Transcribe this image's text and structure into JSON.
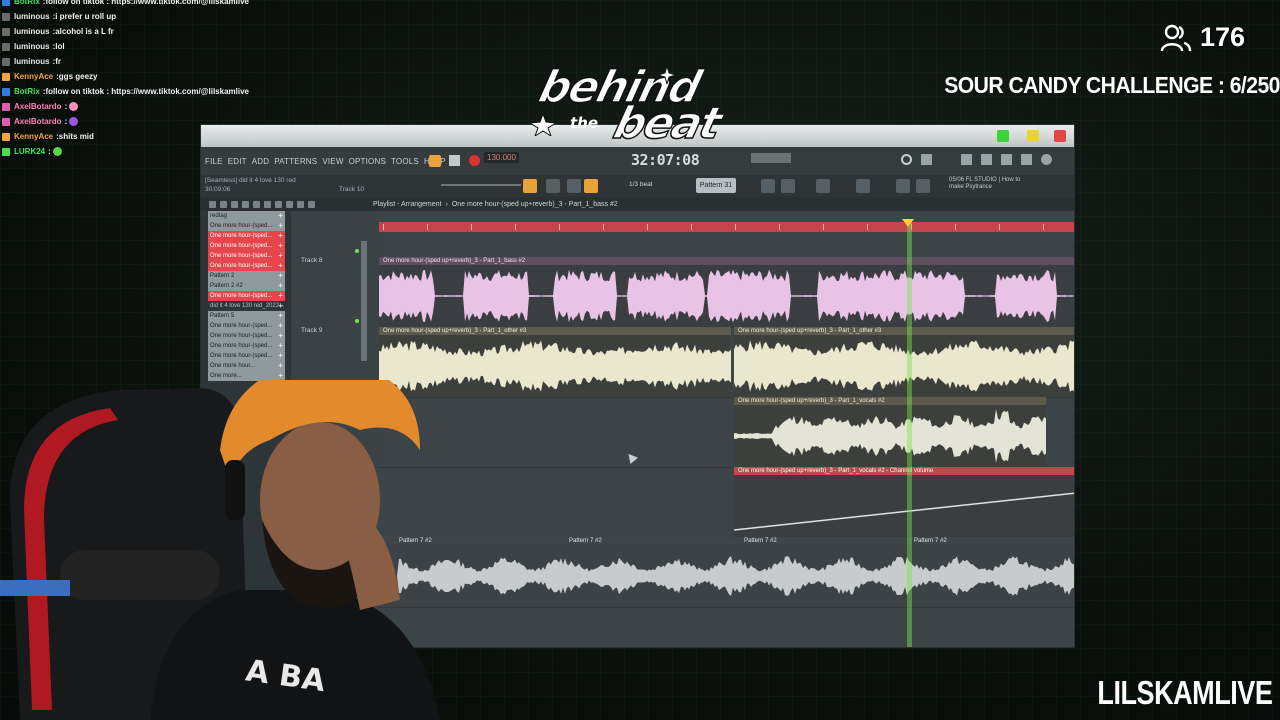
{
  "chat": [
    {
      "user": "BotRix",
      "message": "follow on tiktok : https://www.tiktok.com/@lilskamlive",
      "user_color": "#43e05a",
      "badge": "#2f7de0"
    },
    {
      "user": "luminous",
      "message": "i prefer u roll up",
      "user_color": "#e8e8e8",
      "badge": "#6a6a6a"
    },
    {
      "user": "luminous",
      "message": "alcohol is a L fr",
      "user_color": "#e8e8e8",
      "badge": "#6a6a6a"
    },
    {
      "user": "luminous",
      "message": "lol",
      "user_color": "#e8e8e8",
      "badge": "#6a6a6a"
    },
    {
      "user": "luminous",
      "message": "fr",
      "user_color": "#e8e8e8",
      "badge": "#6a6a6a"
    },
    {
      "user": "KennyAce",
      "message": "ggs geezy",
      "user_color": "#f3a43b",
      "badge": "#f3a43b"
    },
    {
      "user": "BotRix",
      "message": "follow on tiktok : https://www.tiktok.com/@lilskamlive",
      "user_color": "#43e05a",
      "badge": "#2f7de0"
    },
    {
      "user": "AxelBotardo",
      "message": "",
      "user_color": "#ff7eb3",
      "badge": "#e05cb0",
      "emote": "#ff8fbf"
    },
    {
      "user": "AxelBotardo",
      "message": "",
      "user_color": "#ff7eb3",
      "badge": "#e05cb0",
      "emote": "#9b59e8"
    },
    {
      "user": "KennyAce",
      "message": "shits mid",
      "user_color": "#f3a43b",
      "badge": "#f3a43b"
    },
    {
      "user": "LURK24",
      "message": "",
      "user_color": "#43e05a",
      "badge": "#43e05a",
      "emote": "#5ad44a"
    }
  ],
  "viewers": {
    "count": "176",
    "icon": "viewers-icon"
  },
  "challenge_text": "SOUR CANDY CHALLENGE : 6/250",
  "channel_handle": "LILSKAMLIVE",
  "logo": {
    "word1": "behind",
    "word2": "beat",
    "small": "the"
  },
  "fl": {
    "menu": [
      "FILE",
      "EDIT",
      "ADD",
      "PATTERNS",
      "VIEW",
      "OPTIONS",
      "TOOLS",
      "HELP"
    ],
    "time": "32:07:08",
    "tempo": "130.000",
    "pattern": "Pattern 31",
    "snap": "1/3 beat",
    "hint": "[Seamless] did it 4 love 130 red",
    "hint_time": "30:09:06",
    "hint_track": "Track 10",
    "news": "05/06 FL STUDIO | How to make Psytrance",
    "playlist_title": "Playlist - Arrangement",
    "breadcrumb": "One more hour-(sped up+reverb)_3 - Part_1_bass #2",
    "picker": [
      {
        "label": "redtag",
        "style": "grey"
      },
      {
        "label": "One more hour-(sped...",
        "style": "grey"
      },
      {
        "label": "One more hour-(sped...",
        "style": "red"
      },
      {
        "label": "One more hour-(sped...",
        "style": "red"
      },
      {
        "label": "One more hour-(sped...",
        "style": "red"
      },
      {
        "label": "One more hour-(sped...",
        "style": "red"
      },
      {
        "label": "Pattern 2",
        "style": "grey"
      },
      {
        "label": "Pattern 2 #2",
        "style": "grey"
      },
      {
        "label": "One more hour-(sped...",
        "style": "red"
      },
      {
        "label": "did it 4 love 130 red_2022...",
        "style": "plain"
      },
      {
        "label": "Pattern 5",
        "style": "grey"
      },
      {
        "label": "One more hour-(sped...",
        "style": "grey"
      },
      {
        "label": "One more hour-(sped...",
        "style": "grey"
      },
      {
        "label": "One more hour-(sped...",
        "style": "grey"
      },
      {
        "label": "One more hour-(sped...",
        "style": "grey"
      },
      {
        "label": "One more hour...",
        "style": "grey"
      },
      {
        "label": "One more...",
        "style": "grey"
      }
    ],
    "tracks": [
      "Track 8",
      "Track 9"
    ],
    "clips": {
      "bass": "One more hour-(sped up+reverb)_3 - Part_1_bass #2",
      "other1": "One more hour-(sped up+reverb)_3 - Part_1_other #3",
      "other2": "One more hour-(sped up+reverb)_3 - Part_1_other #3",
      "vocals": "One more hour-(sped up+reverb)_3 - Part_1_vocals #2",
      "volume": "One more hour-(sped up+reverb)_3 - Part_1_vocals #2 - Channel volume",
      "pattern": "Pattern 7 #2"
    }
  },
  "colors": {
    "accent_green": "#46d24a",
    "playlist_red": "#c4464c",
    "bass_clip": "#e8c3e6",
    "other_clip": "#eae7cf",
    "vocal_clip": "#d9dbcc"
  }
}
